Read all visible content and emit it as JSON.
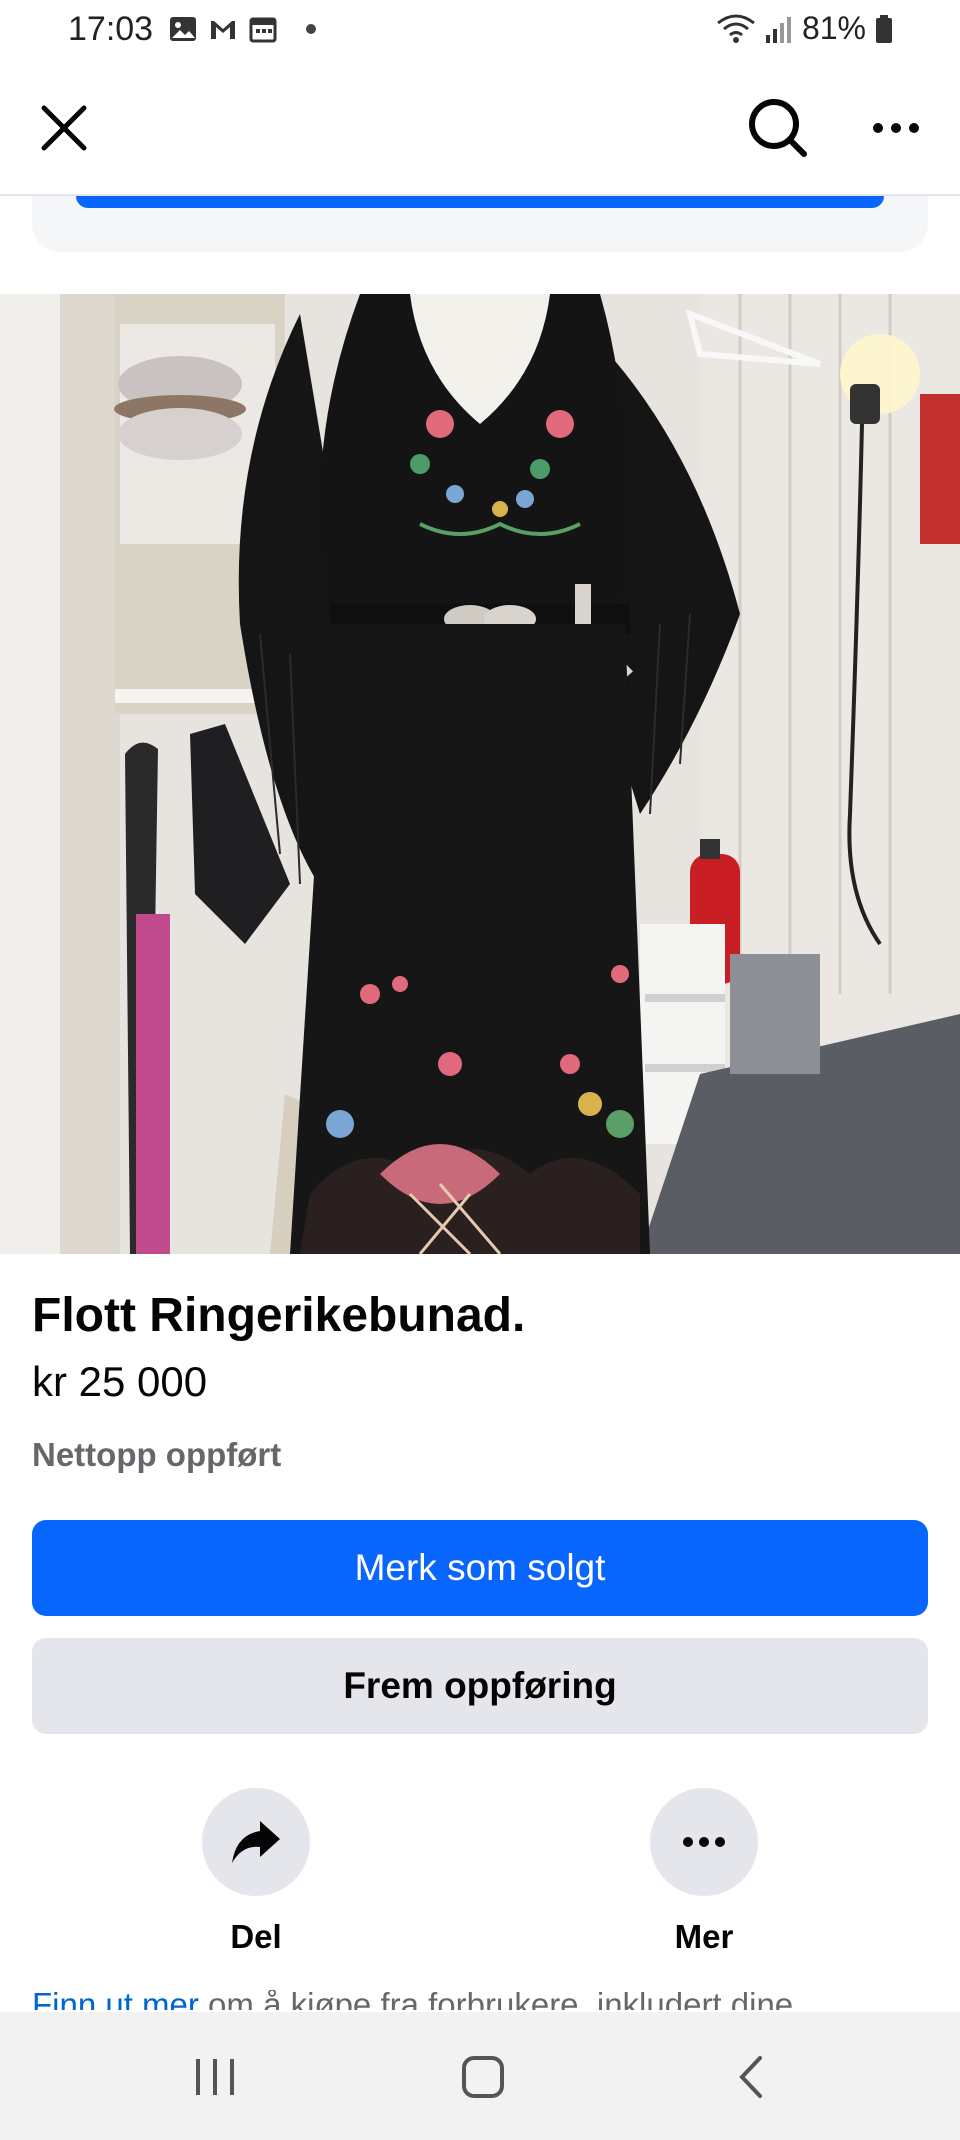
{
  "status_bar": {
    "time": "17:03",
    "left_icons": [
      "image-icon",
      "gmail-icon",
      "calendar-icon"
    ],
    "battery": "81%"
  },
  "app_bar": {
    "close_icon": "close-icon",
    "search_icon": "search-icon",
    "more_icon": "more-horizontal-icon"
  },
  "listing": {
    "title": "Flott Ringerikebunad.",
    "price": "kr 25 000",
    "listed": "Nettopp oppført"
  },
  "buttons": {
    "primary": "Merk som solgt",
    "secondary": "Frem oppføring"
  },
  "actions": [
    {
      "label": "Del",
      "icon": "share-icon"
    },
    {
      "label": "Mer",
      "icon": "more-horizontal-icon"
    }
  ],
  "info": {
    "link": "Finn ut mer",
    "text": " om å kjøpe fra forbrukere, inkludert dine"
  },
  "colors": {
    "accent": "#0866ff",
    "secondary_button": "#e4e6eb",
    "muted_text": "#65676b",
    "link": "#0064d1"
  }
}
